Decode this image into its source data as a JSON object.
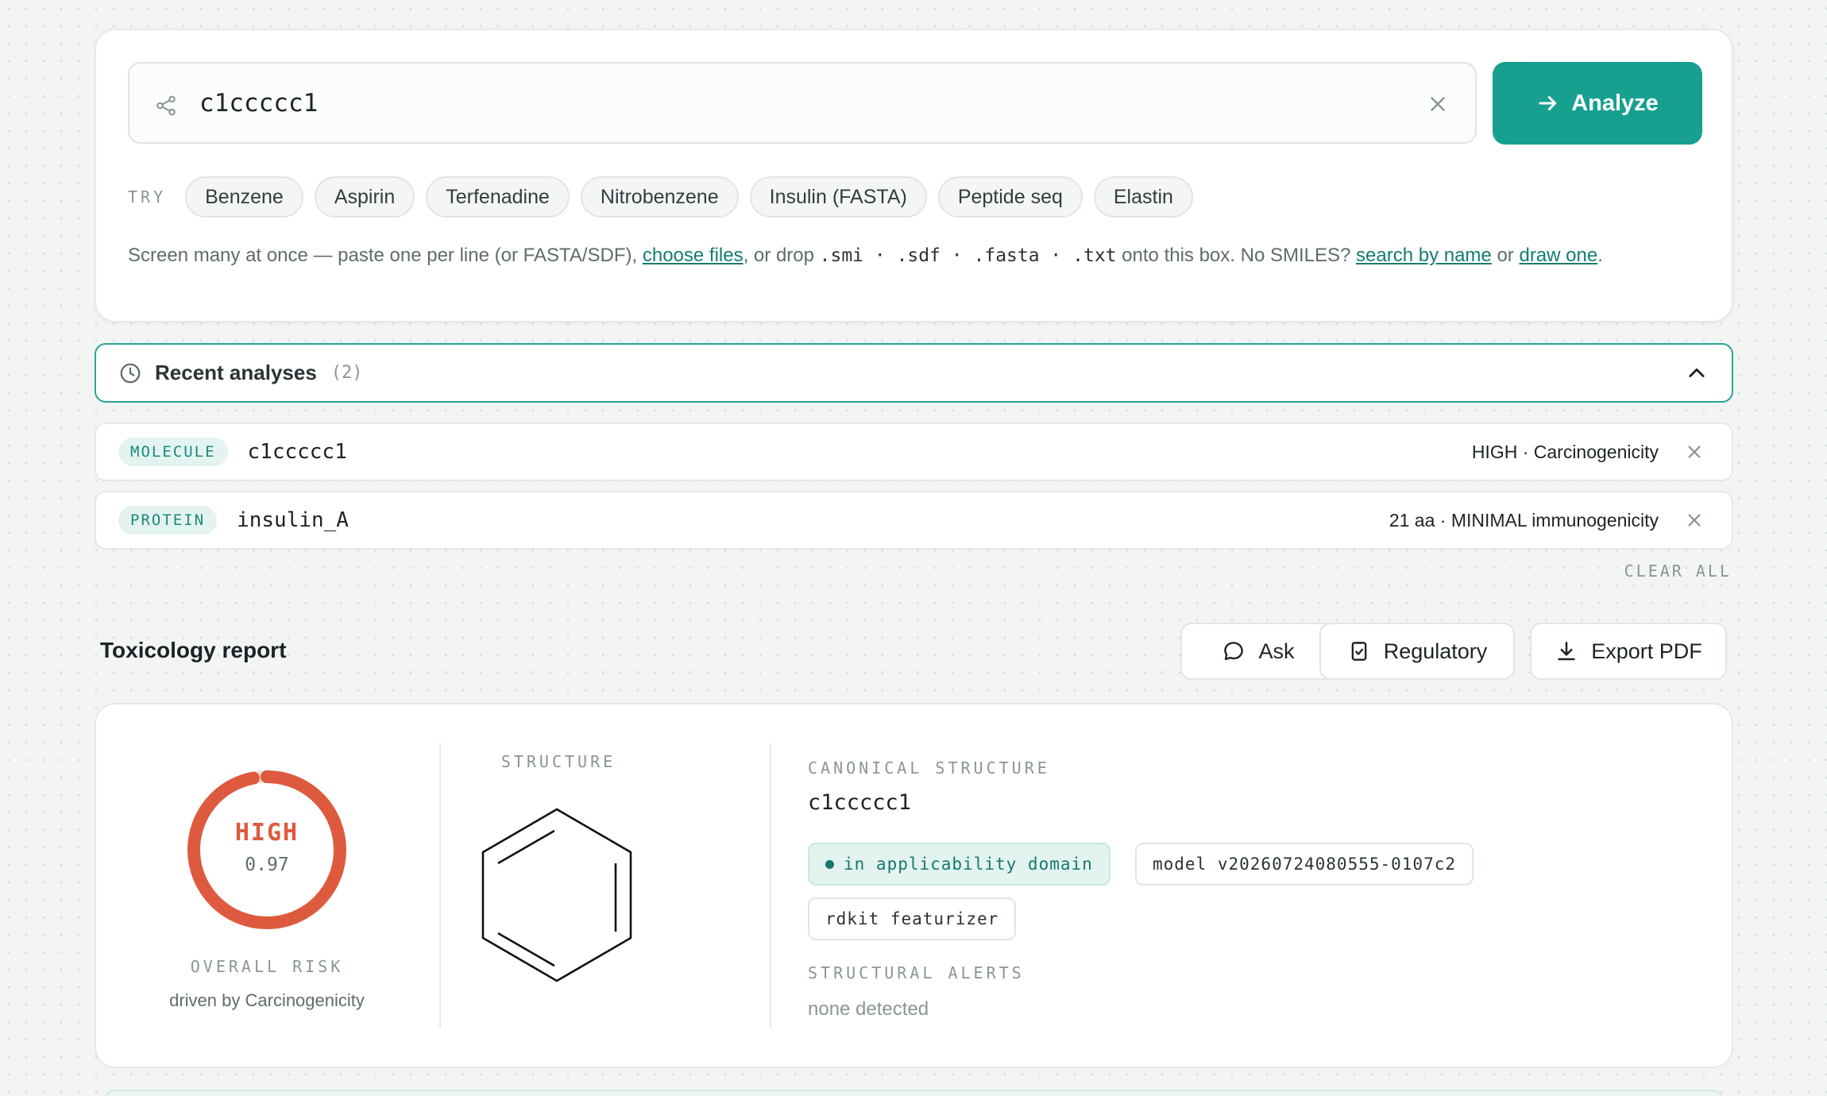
{
  "input": {
    "smiles_value": "c1ccccc1",
    "analyze_label": "Analyze",
    "try_label": "TRY",
    "examples": [
      "Benzene",
      "Aspirin",
      "Terfenadine",
      "Nitrobenzene",
      "Insulin (FASTA)",
      "Peptide seq",
      "Elastin"
    ],
    "help": {
      "part1": "Screen many at once — paste one per line (or FASTA/SDF), ",
      "choose_files": "choose files",
      "part2": ", or drop ",
      "formats": ".smi · .sdf · .fasta · .txt",
      "part3": " onto this box. No SMILES? ",
      "search_by_name": "search by name",
      "part4": " or ",
      "draw_one": "draw one",
      "part5": "."
    }
  },
  "recent": {
    "title": "Recent analyses",
    "count": "(2)",
    "items": [
      {
        "kind": "MOLECULE",
        "name": "c1ccccc1",
        "meta": "HIGH · Carcinogenicity"
      },
      {
        "kind": "PROTEIN",
        "name": "insulin_A",
        "meta": "21 aa · MINIMAL immunogenicity"
      }
    ],
    "clear_all": "CLEAR ALL"
  },
  "report": {
    "title": "Toxicology report",
    "actions": {
      "ask": "Ask",
      "regulatory": "Regulatory",
      "export": "Export PDF"
    },
    "overall": {
      "level": "HIGH",
      "score": "0.97",
      "score_value": 0.97,
      "label": "OVERALL RISK",
      "driven_by": "driven by Carcinogenicity"
    },
    "structure_label": "STRUCTURE",
    "canonical_label": "CANONICAL STRUCTURE",
    "canonical_smiles": "c1ccccc1",
    "tags": {
      "domain": "in applicability domain",
      "model": "model v20260724080555-0107c2",
      "featurizer": "rdkit featurizer"
    },
    "alerts_label": "STRUCTURAL ALERTS",
    "alerts_value": "none detected"
  },
  "colors": {
    "accent": "#17a08f",
    "risk_high": "#de5a3e",
    "background": "#f3f5f5"
  },
  "icons": [
    "share-icon",
    "close-icon",
    "arrow-right-icon",
    "clock-icon",
    "chevron-up-icon",
    "chat-bubble-icon",
    "clipboard-check-icon",
    "download-icon"
  ]
}
